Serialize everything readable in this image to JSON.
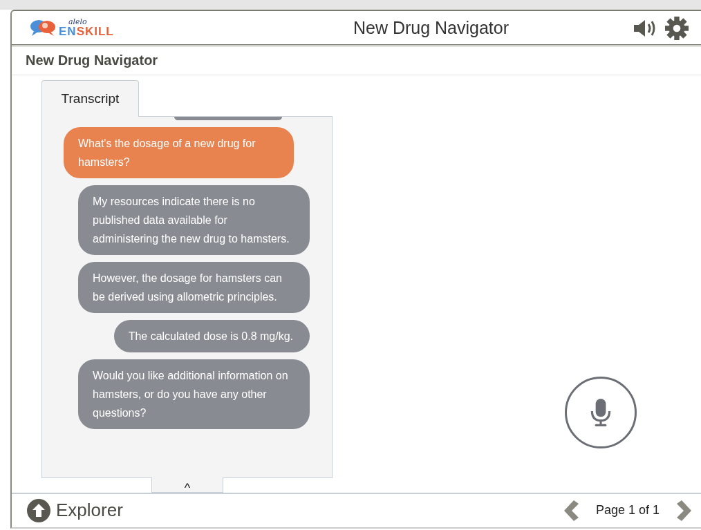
{
  "header": {
    "logo": {
      "tagline": "alelo",
      "parts": [
        {
          "text": "EN",
          "color": "#4a8fd8"
        },
        {
          "text": "SKILL",
          "color": "#e8613a"
        }
      ]
    },
    "title": "New Drug Navigator"
  },
  "subtitle": "New Drug Navigator",
  "tabs": [
    {
      "label": "Transcript",
      "selected": true
    }
  ],
  "messages": [
    {
      "kind": "user",
      "text": "What's the dosage of a new drug for hamsters?"
    },
    {
      "kind": "bot",
      "text": "My resources indicate there is no published data available for administering the new drug to hamsters."
    },
    {
      "kind": "bot",
      "text": "However, the dosage for hamsters can be derived using allometric principles."
    },
    {
      "kind": "bot",
      "text": "The calculated dose is 0.8 mg/kg."
    },
    {
      "kind": "bot",
      "text": "Would you like additional information on hamsters, or do you have any other questions?"
    }
  ],
  "collapse_handle": "^",
  "footer": {
    "explorer": "Explorer",
    "page": "Page 1 of 1"
  }
}
